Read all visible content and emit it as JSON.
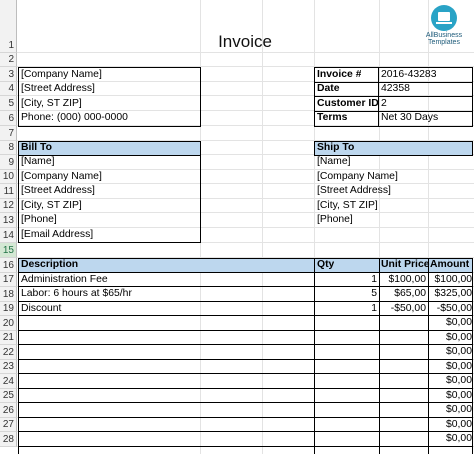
{
  "title": "Invoice",
  "logo": {
    "line1": "AllBusiness",
    "line2": "Templates",
    "icon": "laptop-icon"
  },
  "row_numbers": [
    "1",
    "2",
    "3",
    "4",
    "5",
    "6",
    "7",
    "8",
    "9",
    "10",
    "11",
    "12",
    "13",
    "14",
    "15",
    "16",
    "17",
    "18",
    "19",
    "20",
    "21",
    "22",
    "23",
    "24",
    "25",
    "26",
    "27",
    "28"
  ],
  "selected_row": "15",
  "company": {
    "name": "[Company Name]",
    "street": "[Street Address]",
    "city": "[City, ST ZIP]",
    "phone": "Phone: (000) 000-0000"
  },
  "info": {
    "invoice_label": "Invoice #",
    "invoice_value": "2016-43283",
    "date_label": "Date",
    "date_value": "42358",
    "customer_label": "Customer ID",
    "customer_value": "2",
    "terms_label": "Terms",
    "terms_value": "Net 30 Days"
  },
  "bill_to": {
    "header": "Bill To",
    "lines": [
      "[Name]",
      "[Company Name]",
      "[Street Address]",
      "[City, ST ZIP]",
      "[Phone]",
      "[Email Address]"
    ]
  },
  "ship_to": {
    "header": "Ship To",
    "lines": [
      "[Name]",
      "[Company Name]",
      "[Street Address]",
      "[City, ST ZIP]",
      "[Phone]"
    ]
  },
  "items": {
    "headers": {
      "description": "Description",
      "qty": "Qty",
      "unit_price": "Unit Price",
      "amount": "Amount"
    },
    "rows": [
      {
        "description": "Administration Fee",
        "qty": "1",
        "unit_price": "$100,00",
        "amount": "$100,00"
      },
      {
        "description": "Labor: 6 hours at $65/hr",
        "qty": "5",
        "unit_price": "$65,00",
        "amount": "$325,00"
      },
      {
        "description": "Discount",
        "qty": "1",
        "unit_price": "-$50,00",
        "amount": "-$50,00"
      },
      {
        "description": "",
        "qty": "",
        "unit_price": "",
        "amount": "$0,00"
      },
      {
        "description": "",
        "qty": "",
        "unit_price": "",
        "amount": "$0,00"
      },
      {
        "description": "",
        "qty": "",
        "unit_price": "",
        "amount": "$0,00"
      },
      {
        "description": "",
        "qty": "",
        "unit_price": "",
        "amount": "$0,00"
      },
      {
        "description": "",
        "qty": "",
        "unit_price": "",
        "amount": "$0,00"
      },
      {
        "description": "",
        "qty": "",
        "unit_price": "",
        "amount": "$0,00"
      },
      {
        "description": "",
        "qty": "",
        "unit_price": "",
        "amount": "$0,00"
      },
      {
        "description": "",
        "qty": "",
        "unit_price": "",
        "amount": "$0,00"
      },
      {
        "description": "",
        "qty": "",
        "unit_price": "",
        "amount": "$0,00"
      }
    ]
  },
  "colors": {
    "header_fill": "#bdd7ee",
    "selected_row": "#d4e8d4",
    "logo": "#29a3c6"
  }
}
